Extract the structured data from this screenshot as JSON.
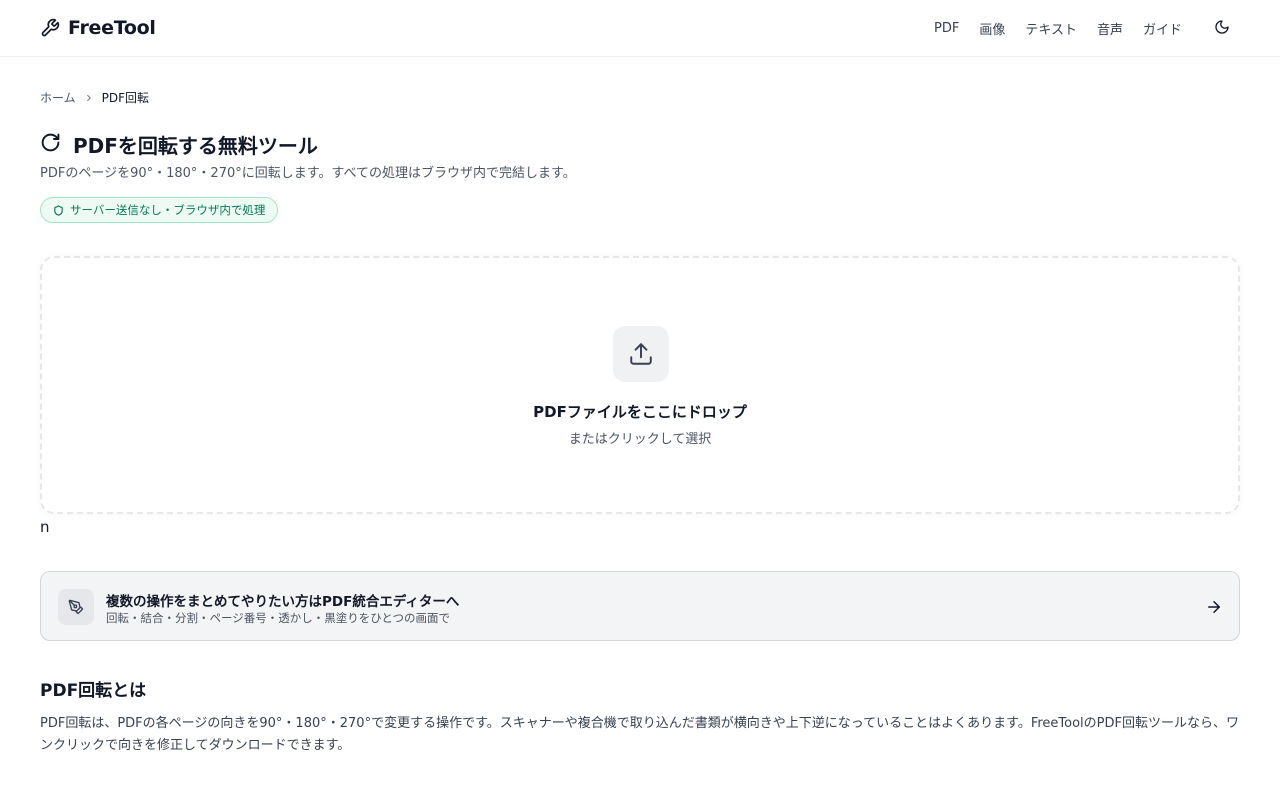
{
  "header": {
    "logo_text": "FreeTool",
    "logo_icon": "wrench-icon",
    "nav": [
      {
        "label": "PDF"
      },
      {
        "label": "画像"
      },
      {
        "label": "テキスト"
      },
      {
        "label": "音声"
      },
      {
        "label": "ガイド"
      }
    ],
    "theme_icon": "moon-icon"
  },
  "breadcrumb": {
    "home": "ホーム",
    "current": "PDF回転"
  },
  "page": {
    "title": "PDFを回転する無料ツール",
    "title_icon": "rotate-icon",
    "description": "PDFのページを90°・180°・270°に回転します。すべての処理はブラウザ内で完結します。",
    "privacy_badge": "サーバー送信なし・ブラウザ内で処理",
    "privacy_icon": "shield-icon"
  },
  "dropzone": {
    "title": "PDFファイルをここにドロップ",
    "subtitle": "またはクリックして選択",
    "icon": "upload-icon"
  },
  "stray_text": "n",
  "editor_card": {
    "title": "複数の操作をまとめてやりたい方はPDF統合エディターへ",
    "subtitle": "回転・結合・分割・ページ番号・透かし・黒塗りをひとつの画面で",
    "icon": "pen-tool-icon",
    "arrow_icon": "arrow-right-icon"
  },
  "about": {
    "title": "PDF回転とは",
    "body": "PDF回転は、PDFの各ページの向きを90°・180°・270°で変更する操作です。スキャナーや複合機で取り込んだ書類が横向きや上下逆になっていることはよくあります。FreeToolのPDF回転ツールなら、ワンクリックで向きを修正してダウンロードできます。"
  },
  "colors": {
    "accent_green": "#047857",
    "badge_bg": "#eefbf4",
    "text_primary": "#111827",
    "text_secondary": "#4b5563"
  }
}
